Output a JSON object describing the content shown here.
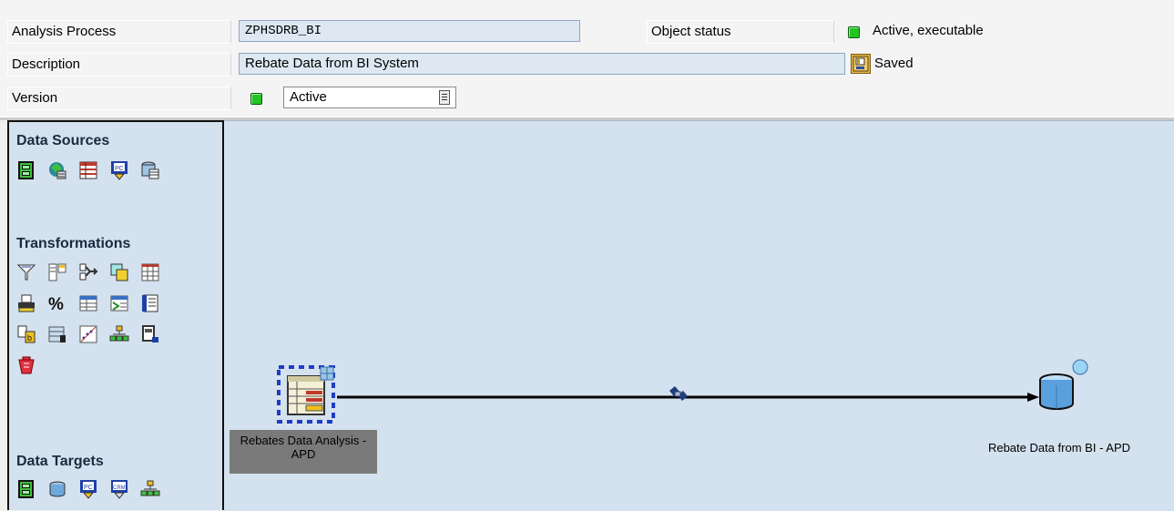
{
  "header": {
    "analysis_process_label": "Analysis Process",
    "analysis_process_value": "ZPHSDRB_BI",
    "object_status_label": "Object status",
    "object_status_value": "Active, executable",
    "description_label": "Description",
    "description_value": "Rebate Data from BI System",
    "saved_label": "Saved",
    "version_label": "Version",
    "version_value": "Active",
    "status_color": "#22c522"
  },
  "palette": {
    "sources_title": "Data Sources",
    "transformations_title": "Transformations",
    "targets_title": "Data Targets",
    "source_icons": [
      "infoprovider-icon",
      "query-icon",
      "database-table-icon",
      "flat-file-icon",
      "attributes-icon"
    ],
    "transformation_icons": [
      "filter-icon",
      "restrict-icon",
      "join-icon",
      "union-icon",
      "transpose-icon",
      "aggregate-icon",
      "formula-icon",
      "list-icon",
      "routine-icon",
      "sort-icon",
      "data-mining-icon",
      "table-icon",
      "regression-icon",
      "hierarchy-icon",
      "abc-icon",
      "delete-icon"
    ],
    "target_icons": [
      "infoprovider-target-icon",
      "database-target-icon",
      "file-target-icon",
      "crm-target-icon",
      "hierarchy-target-icon"
    ]
  },
  "canvas": {
    "source_node_label": "Rebates Data Analysis - APD",
    "target_node_label": "Rebate Data from BI - APD"
  }
}
